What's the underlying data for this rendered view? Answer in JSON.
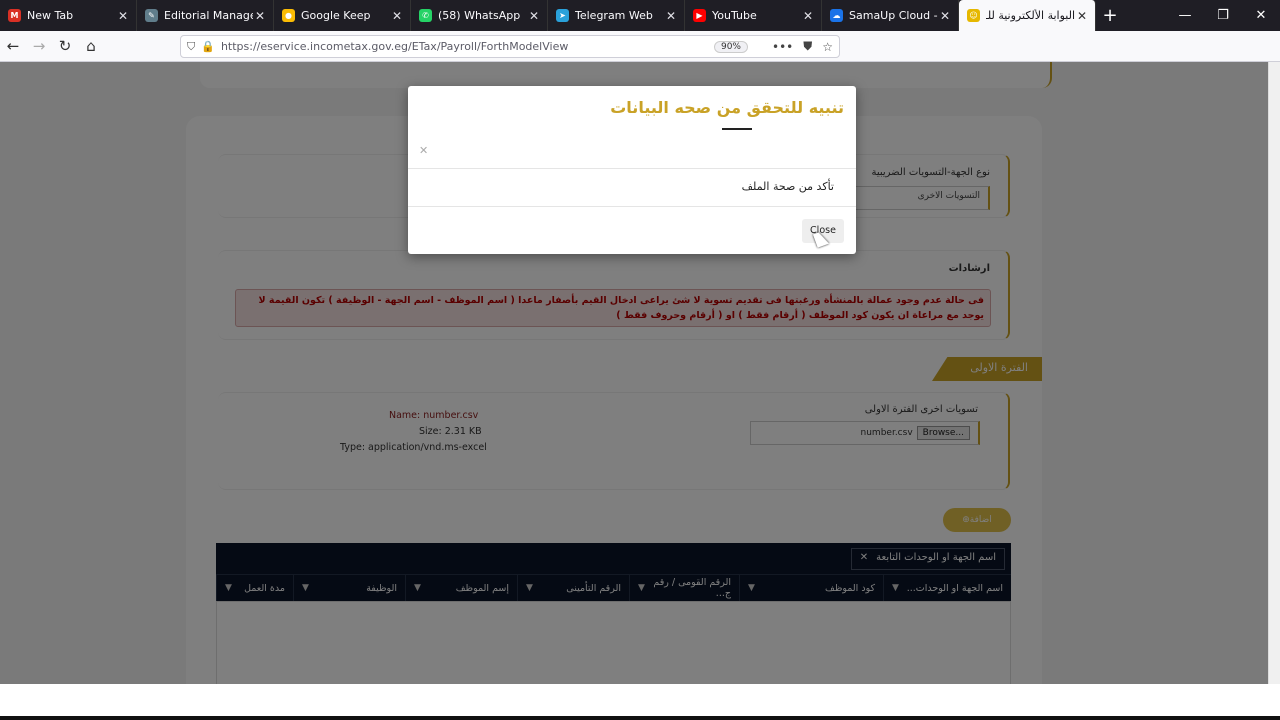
{
  "browser": {
    "tabs": [
      {
        "title": "New Tab",
        "fav_color": "#d93025",
        "fav_glyph": "M",
        "active": false
      },
      {
        "title": "Editorial Manager®",
        "fav_color": "#607d8b",
        "fav_glyph": "✎",
        "active": false
      },
      {
        "title": "Google Keep",
        "fav_color": "#fbbc04",
        "fav_glyph": "●",
        "active": false
      },
      {
        "title": "(58) WhatsApp",
        "fav_color": "#25d366",
        "fav_glyph": "✆",
        "active": false
      },
      {
        "title": "Telegram Web",
        "fav_color": "#2aa1da",
        "fav_glyph": "➤",
        "active": false
      },
      {
        "title": "YouTube",
        "fav_color": "#ff0000",
        "fav_glyph": "▶",
        "active": false
      },
      {
        "title": "SamaUp Cloud - M",
        "fav_color": "#1a73e8",
        "fav_glyph": "☁",
        "active": false
      },
      {
        "title": "البوابة الألكترونية للـ",
        "fav_color": "#e6b800",
        "fav_glyph": "☺",
        "active": true
      }
    ],
    "url": "https://eservice.incometax.gov.eg/ETax/Payroll/ForthModelView",
    "zoom": "90%"
  },
  "page": {
    "entity_type_label": "نوع الجهة-التسويات الضريبية",
    "entity_type_value": "التسويات الاخرى",
    "guidance_label": "ارشادات",
    "guidance_text": "فى حالة عدم وجود عمالة بالمنشأة ورغبتها فى تقديم تسوية لا شئ يراعى ادخال القيم بأصفار ماعدا ( اسم الموظف - اسم الجهة - الوظيفة ) تكون القيمة لا يوجد مع مراعاة ان يكون كود الموظف ( أرقام فقط ) او ( أرقام وحروف فقط )",
    "period_tag": "الفترة الاولى",
    "upload_label": "تسويات اخرى الفترة الاولى",
    "file_name_display": "number.csv",
    "browse_label": "Browse...",
    "file_name": "Name: number.csv",
    "file_size": "Size: 2.31 KB",
    "file_type": "Type: application/vnd.ms-excel",
    "add_button": "اضافة",
    "grid_group": "اسم الجهة او الوحدات التابعة",
    "grid_columns": [
      "اسم الجهة او الوحدات...",
      "كود الموظف",
      "الرقم القومى / رقم ج...",
      "الرقم التأمينى",
      "إسم الموظف",
      "الوظيفة",
      "مدة العمل"
    ]
  },
  "modal": {
    "title": "تنبيه للتحقق من صحه البيانات",
    "body": "تأكد من صحة الملف",
    "close_label": "Close"
  }
}
